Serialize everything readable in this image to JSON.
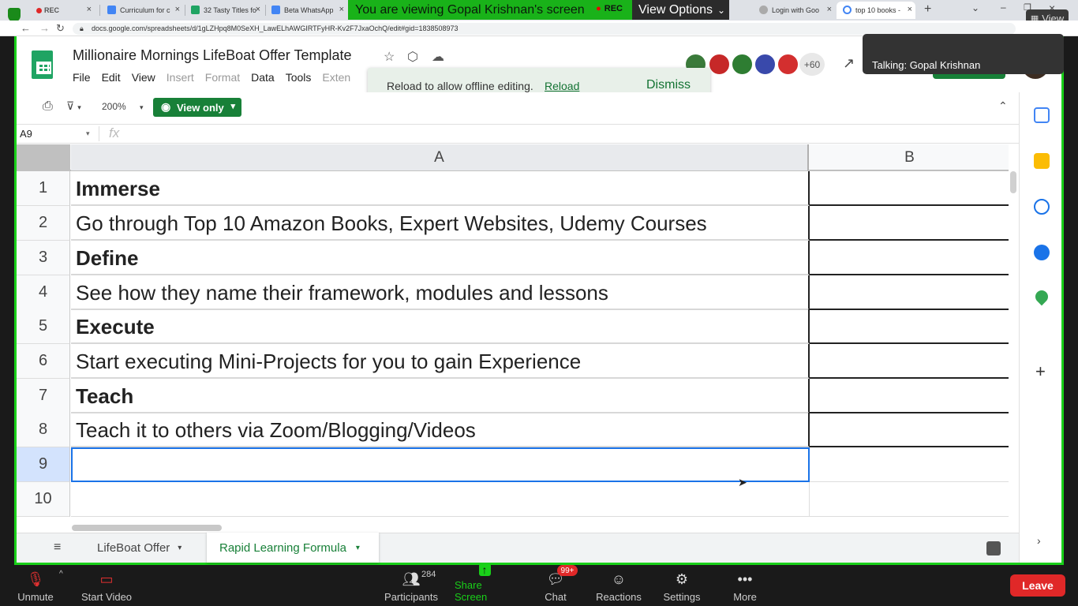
{
  "browser": {
    "tabs": [
      {
        "label": "REC"
      },
      {
        "label": "Curriculum for c"
      },
      {
        "label": "32 Tasty Titles fo"
      },
      {
        "label": "Beta WhatsApp"
      },
      {
        "label": "Login with Goo"
      },
      {
        "label": "top 10 books - "
      }
    ],
    "url": "docs.google.com/spreadsheets/d/1gLZHpq8M0SeXH_LawELhAWGIRTFyHR-Kv2F7JxaOchQ/edit#gid=1838508973"
  },
  "zoom": {
    "banner": "You are viewing Gopal Krishnan's screen",
    "rec_label": "REC",
    "view_options": "View Options",
    "view_button": "View",
    "talking": "Talking: Gopal Krishnan",
    "controls": {
      "unmute": "Unmute",
      "start_video": "Start Video",
      "participants": "Participants",
      "participants_count": "284",
      "share_screen": "Share Screen",
      "chat": "Chat",
      "chat_badge": "99+",
      "reactions": "Reactions",
      "settings": "Settings",
      "more": "More",
      "leave": "Leave"
    }
  },
  "sheets": {
    "title": "Millionaire Mornings LifeBoat Offer Template",
    "menu": [
      "File",
      "Edit",
      "View",
      "Insert",
      "Format",
      "Data",
      "Tools",
      "Exten"
    ],
    "zoom_level": "200%",
    "view_only": "View only",
    "namebox": "A9",
    "fx": "fx",
    "more_collaborators": "+60",
    "toast": {
      "message": "Reload to allow offline editing.",
      "reload": "Reload",
      "dismiss": "Dismiss"
    },
    "columns": [
      "A",
      "B"
    ],
    "rows": [
      {
        "num": "1",
        "text": "Immerse",
        "bold": true
      },
      {
        "num": "2",
        "text": "Go through Top 10 Amazon Books, Expert Websites, Udemy Courses",
        "bold": false
      },
      {
        "num": "3",
        "text": "Define",
        "bold": true
      },
      {
        "num": "4",
        "text": "See how they name their framework, modules and lessons",
        "bold": false
      },
      {
        "num": "5",
        "text": "Execute",
        "bold": true
      },
      {
        "num": "6",
        "text": "Start executing Mini-Projects for you to gain Experience",
        "bold": false
      },
      {
        "num": "7",
        "text": "Teach",
        "bold": true
      },
      {
        "num": "8",
        "text": "Teach it to others via Zoom/Blogging/Videos",
        "bold": false
      },
      {
        "num": "9",
        "text": "",
        "bold": false
      },
      {
        "num": "10",
        "text": "",
        "bold": false
      }
    ],
    "sheet_tabs": [
      "LifeBoat Offer",
      "Rapid Learning Formula"
    ],
    "active_sheet": "Rapid Learning Formula"
  }
}
